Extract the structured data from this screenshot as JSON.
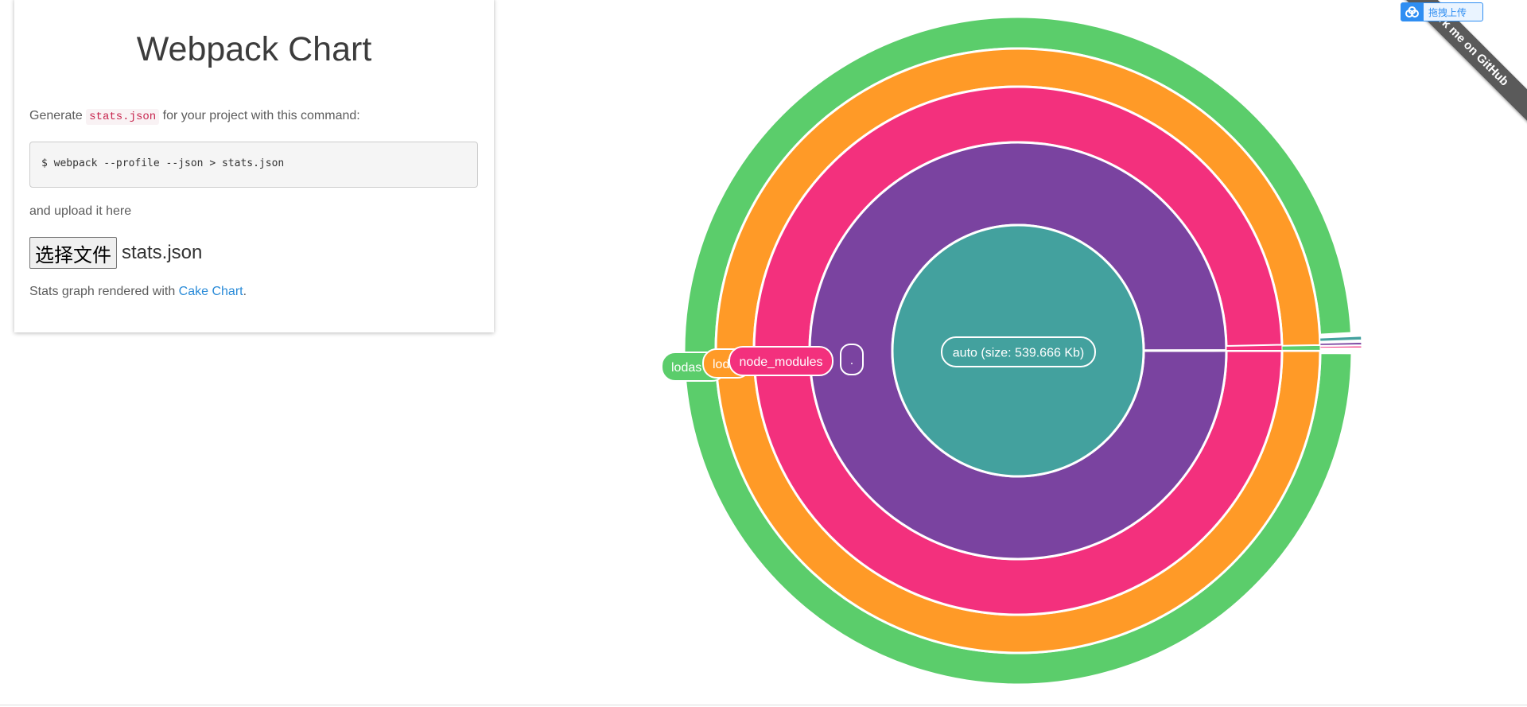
{
  "panel": {
    "title": "Webpack Chart",
    "intro_before": "Generate ",
    "intro_code": "stats.json",
    "intro_after": " for your project with this command:",
    "command": "$ webpack --profile --json > stats.json",
    "upload_text": "and upload it here",
    "file_button_label": "选择文件",
    "file_name": "stats.json",
    "credit_before": "Stats graph rendered with ",
    "credit_link": "Cake Chart",
    "credit_after": "."
  },
  "ribbon": {
    "label": "Fork me on GitHub"
  },
  "upload_badge": {
    "label": "拖拽上传",
    "icon": "cloud-upload-icon"
  },
  "chart_data": {
    "type": "sunburst",
    "root": {
      "label": "auto (size: 539.666 Kb)",
      "size_kb": 539.666
    },
    "rings": [
      {
        "name": ".",
        "color": "#7a43a0"
      },
      {
        "name": "node_modules",
        "color": "#f3307d"
      },
      {
        "name": "lod",
        "color": "#ff9a27"
      },
      {
        "name": "lodas",
        "color": "#5bcd6b"
      }
    ],
    "center_color": "#43a19e"
  }
}
